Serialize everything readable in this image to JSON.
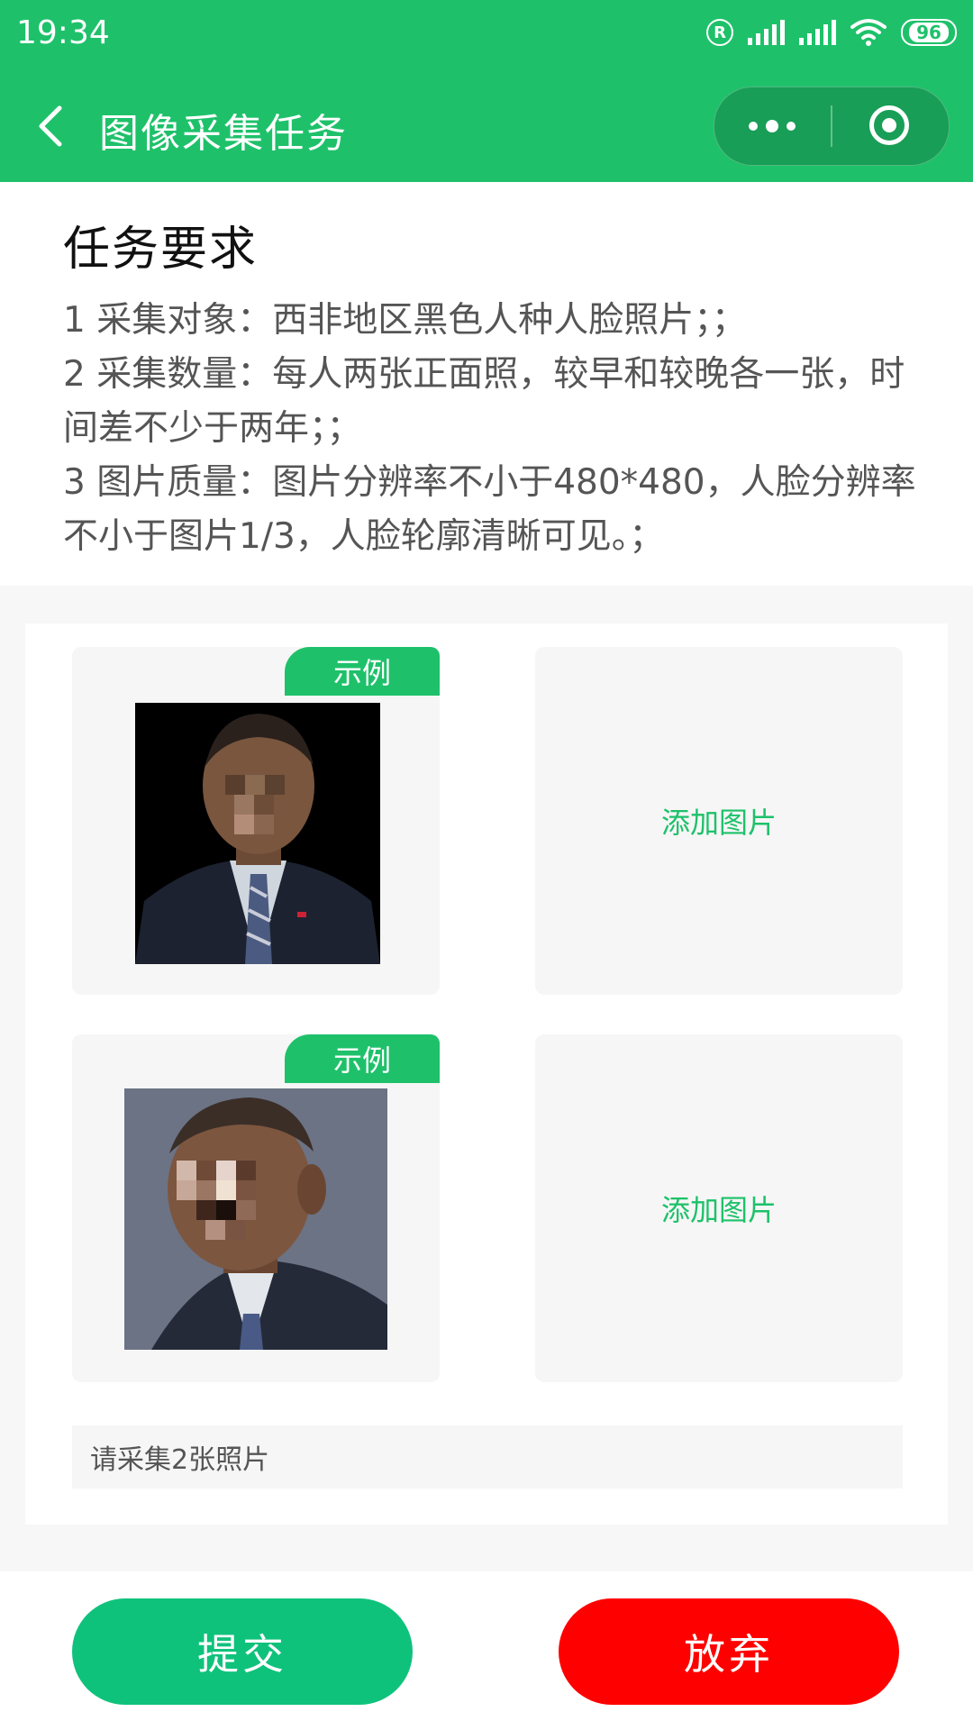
{
  "status_bar": {
    "time": "19:34",
    "battery": "96",
    "icons": [
      "registered-icon",
      "signal-icon",
      "signal-icon",
      "wifi-icon",
      "battery-icon"
    ]
  },
  "nav": {
    "title": "图像采集任务",
    "back_icon": "chevron-left-icon",
    "more_icon": "more-icon",
    "close_icon": "target-icon"
  },
  "requirements": {
    "heading": "任务要求",
    "line1": " 1 采集对象：西非地区黑色人种人脸照片；；",
    "line2": " 2 采集数量：每人两张正面照，较早和较晚各一张，时间差不少于两年；；",
    "line3": " 3 图片质量：图片分辨率不小于480*480，人脸分辨率不小于图片1/3，人脸轮廓清晰可见。；"
  },
  "upload": {
    "example_badge_1": "示例",
    "example_badge_2": "示例",
    "add_label_1": "添加图片",
    "add_label_2": "添加图片",
    "hint": "请采集2张照片"
  },
  "actions": {
    "submit": "提交",
    "abandon": "放弃"
  },
  "colors": {
    "brand_green": "#1ec16a",
    "submit_green": "#0fc27c",
    "abandon_red": "#ff0000"
  }
}
